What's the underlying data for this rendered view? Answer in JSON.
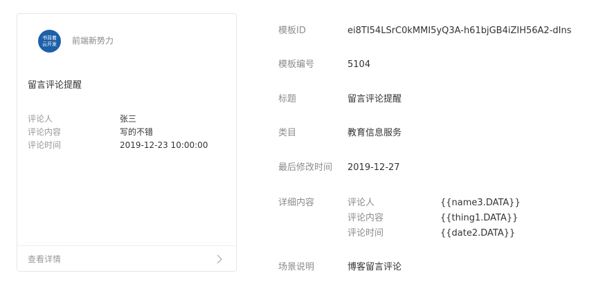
{
  "preview": {
    "account": {
      "avatar_text_line1": "书背着",
      "avatar_text_line2": "云开发",
      "name": "前端新势力"
    },
    "title": "留言评论提醒",
    "fields": [
      {
        "label": "评论人",
        "value": "张三"
      },
      {
        "label": "评论内容",
        "value": "写的不错"
      },
      {
        "label": "评论时间",
        "value": "2019-12-23 10:00:00"
      }
    ],
    "footer_link": "查看详情",
    "accent_color": "#1d5fa8"
  },
  "info": {
    "template_id": {
      "label": "模板ID",
      "value": "ei8TI54LSrC0kMMI5yQ3A-h61bjGB4iZIH56A2-dIns"
    },
    "template_number": {
      "label": "模板编号",
      "value": "5104"
    },
    "title": {
      "label": "标题",
      "value": "留言评论提醒"
    },
    "category": {
      "label": "类目",
      "value": "教育信息服务"
    },
    "last_modified": {
      "label": "最后修改时间",
      "value": "2019-12-27"
    },
    "detail": {
      "label": "详细内容",
      "items": [
        {
          "key": "评论人",
          "value": "{{name3.DATA}}"
        },
        {
          "key": "评论内容",
          "value": "{{thing1.DATA}}"
        },
        {
          "key": "评论时间",
          "value": "{{date2.DATA}}"
        }
      ]
    },
    "scenario": {
      "label": "场景说明",
      "value": "博客留言评论"
    }
  }
}
